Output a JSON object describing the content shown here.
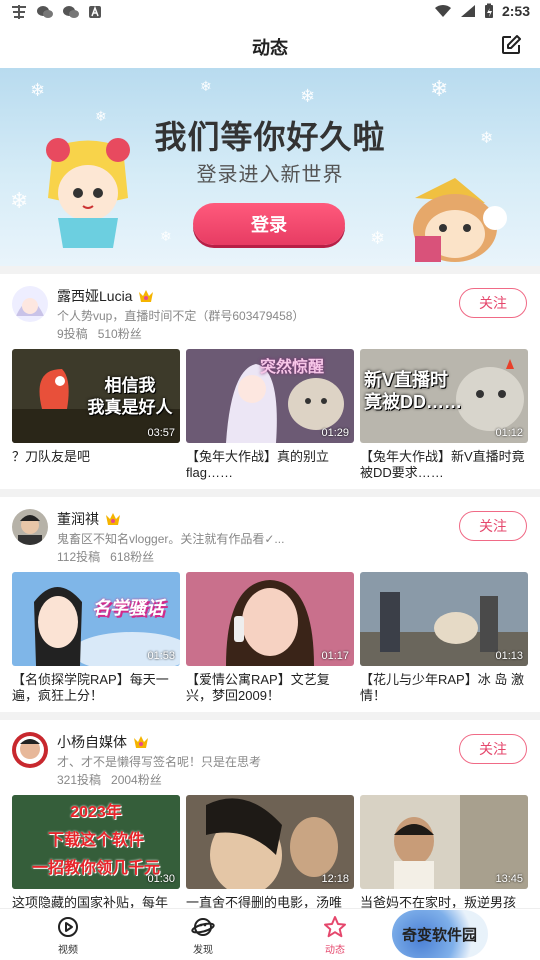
{
  "status_bar": {
    "time": "2:53"
  },
  "header": {
    "title": "动态"
  },
  "banner": {
    "headline": "我们等你好久啦",
    "subtitle": "登录进入新世界",
    "login_label": "登录"
  },
  "uploaders": [
    {
      "name": "露西娅Lucia",
      "desc": "个人势vup，直播时间不定（群号603479458）",
      "posts": "9投稿",
      "fans": "510粉丝",
      "follow": "关注",
      "videos": [
        {
          "title": "？刀队友是吧",
          "duration": "03:57",
          "overlay": "相信我\n我真是好人"
        },
        {
          "title": "【兔年大作战】真的别立flag……",
          "duration": "01:29",
          "overlay": "突然惊醒"
        },
        {
          "title": "【兔年大作战】新V直播时竟被DD要求……",
          "duration": "01:12",
          "overlay": "新V直播时\n竟被DD……"
        }
      ]
    },
    {
      "name": "董润祺",
      "desc": "鬼畜区不知名vlogger。关注就有作品看✓...",
      "posts": "112投稿",
      "fans": "618粉丝",
      "follow": "关注",
      "videos": [
        {
          "title": "【名侦探学院RAP】每天一遍，疯狂上分！",
          "duration": "01:53",
          "overlay": "名学骚话"
        },
        {
          "title": "【爱情公寓RAP】文艺复兴，梦回2009！",
          "duration": "01:17",
          "overlay": ""
        },
        {
          "title": "【花儿与少年RAP】冰 岛 激 情！",
          "duration": "01:13",
          "overlay": ""
        }
      ]
    },
    {
      "name": "小杨自媒体",
      "desc": "才、才不是懒得写签名呢！只是在思考",
      "posts": "321投稿",
      "fans": "2004粉丝",
      "follow": "关注",
      "videos": [
        {
          "title": "这项隐藏的国家补贴，每年",
          "duration": "01:30",
          "overlay": "2023年\n下载这个软件\n一招教你领几千元"
        },
        {
          "title": "一直舍不得删的电影，汤唯",
          "duration": "12:18",
          "overlay": ""
        },
        {
          "title": "当爸妈不在家时，叛逆男孩",
          "duration": "13:45",
          "overlay": ""
        }
      ]
    }
  ],
  "nav": {
    "items": [
      {
        "label": "视频",
        "icon": "video-icon"
      },
      {
        "label": "发现",
        "icon": "discover-planet-icon"
      },
      {
        "label": "动态",
        "icon": "star-icon"
      }
    ]
  },
  "watermark": "奇变软件园",
  "colors": {
    "accent": "#e5476c",
    "follow_border": "#f06a86",
    "banner_bg": "#cfe7f5"
  }
}
